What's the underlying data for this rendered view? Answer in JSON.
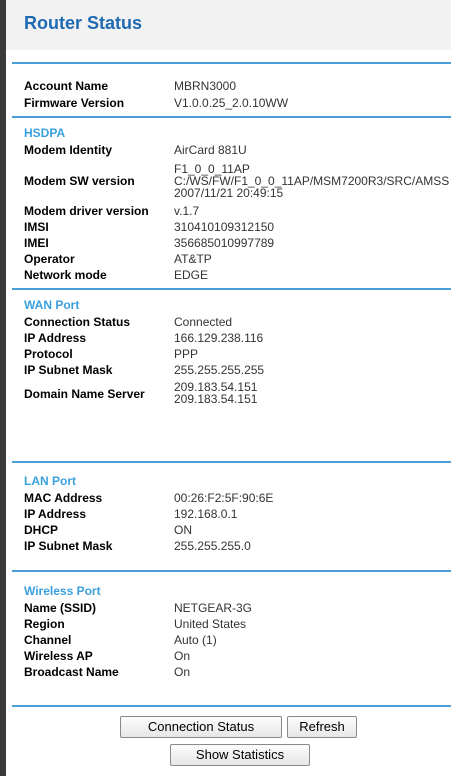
{
  "title": "Router Status",
  "general": {
    "rows": [
      {
        "label": "Account Name",
        "value": "MBRN3000"
      },
      {
        "label": "Firmware Version",
        "value": "V1.0.0.25_2.0.10WW"
      }
    ]
  },
  "hsdpa": {
    "title": "HSDPA",
    "modem_identity": {
      "label": "Modem Identity",
      "value": "AirCard 881U"
    },
    "modem_sw": {
      "label": "Modem SW version",
      "line1": "F1_0_0_11AP",
      "line2": "C:/WS/FW/F1_0_0_11AP/MSM7200R3/SRC/AMSS",
      "line3": "2007/11/21 20:49:15"
    },
    "rows": [
      {
        "label": "Modem driver version",
        "value": "v.1.7"
      },
      {
        "label": "IMSI",
        "value": "310410109312150"
      },
      {
        "label": "IMEI",
        "value": "356685010997789"
      },
      {
        "label": "Operator",
        "value": "AT&TP"
      },
      {
        "label": "Network mode",
        "value": "EDGE"
      }
    ]
  },
  "wan": {
    "title": "WAN Port",
    "rows": [
      {
        "label": "Connection Status",
        "value": "Connected"
      },
      {
        "label": "IP Address",
        "value": "166.129.238.116"
      },
      {
        "label": "Protocol",
        "value": "PPP"
      },
      {
        "label": "IP Subnet Mask",
        "value": "255.255.255.255"
      }
    ],
    "dns": {
      "label": "Domain Name Server",
      "line1": "209.183.54.151",
      "line2": "209.183.54.151"
    }
  },
  "lan": {
    "title": "LAN Port",
    "rows": [
      {
        "label": "MAC Address",
        "value": "00:26:F2:5F:90:6E"
      },
      {
        "label": "IP Address",
        "value": "192.168.0.1"
      },
      {
        "label": "DHCP",
        "value": "ON"
      },
      {
        "label": "IP Subnet Mask",
        "value": "255.255.255.0"
      }
    ]
  },
  "wireless": {
    "title": "Wireless Port",
    "rows": [
      {
        "label": "Name (SSID)",
        "value": "NETGEAR-3G"
      },
      {
        "label": "Region",
        "value": "United States"
      },
      {
        "label": "Channel",
        "value": "Auto (1)"
      },
      {
        "label": "Wireless AP",
        "value": "On"
      },
      {
        "label": "Broadcast Name",
        "value": "On"
      }
    ]
  },
  "buttons": {
    "connection_status": "Connection Status",
    "refresh": "Refresh",
    "show_statistics": "Show Statistics"
  }
}
